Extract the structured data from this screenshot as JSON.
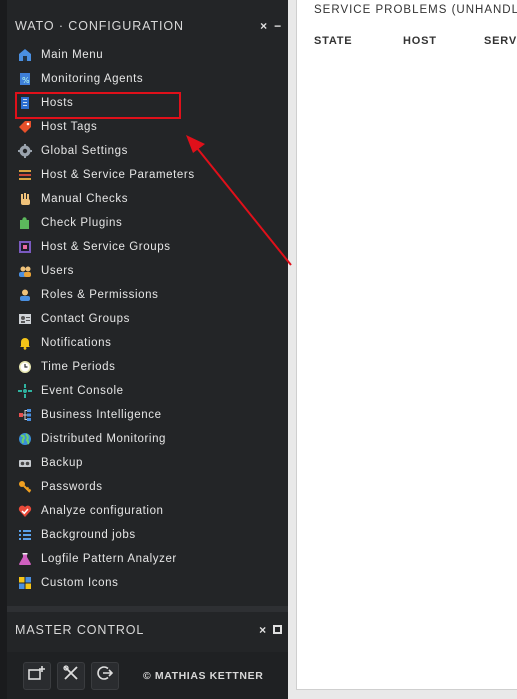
{
  "snapin_config": {
    "title": "WATO · CONFIGURATION",
    "close": "×",
    "minimize": "−"
  },
  "menu": [
    {
      "label": "Main Menu",
      "icon": "main-menu-icon"
    },
    {
      "label": "Monitoring Agents",
      "icon": "agents-icon"
    },
    {
      "label": "Hosts",
      "icon": "hosts-icon"
    },
    {
      "label": "Host Tags",
      "icon": "tag-icon"
    },
    {
      "label": "Global Settings",
      "icon": "gear-icon"
    },
    {
      "label": "Host & Service Parameters",
      "icon": "rulesets-icon"
    },
    {
      "label": "Manual Checks",
      "icon": "hand-icon"
    },
    {
      "label": "Check Plugins",
      "icon": "puzzle-icon"
    },
    {
      "label": "Host & Service Groups",
      "icon": "groups-icon"
    },
    {
      "label": "Users",
      "icon": "users-icon"
    },
    {
      "label": "Roles & Permissions",
      "icon": "roles-icon"
    },
    {
      "label": "Contact Groups",
      "icon": "contact-groups-icon"
    },
    {
      "label": "Notifications",
      "icon": "bell-icon"
    },
    {
      "label": "Time Periods",
      "icon": "clock-icon"
    },
    {
      "label": "Event Console",
      "icon": "event-console-icon"
    },
    {
      "label": "Business Intelligence",
      "icon": "bi-icon"
    },
    {
      "label": "Distributed Monitoring",
      "icon": "globe-icon"
    },
    {
      "label": "Backup",
      "icon": "backup-icon"
    },
    {
      "label": "Passwords",
      "icon": "key-icon"
    },
    {
      "label": "Analyze configuration",
      "icon": "heart-check-icon"
    },
    {
      "label": "Background jobs",
      "icon": "list-icon"
    },
    {
      "label": "Logfile Pattern Analyzer",
      "icon": "flask-icon"
    },
    {
      "label": "Custom Icons",
      "icon": "custom-icons-icon"
    }
  ],
  "snapin_master": {
    "title": "MASTER CONTROL",
    "close": "×"
  },
  "footer": {
    "copyright": "© MATHIAS KETTNER"
  },
  "main": {
    "title": "SERVICE PROBLEMS (UNHANDLED)",
    "columns": [
      "STATE",
      "HOST",
      "SERVICE"
    ]
  },
  "colors": {
    "sidebar_bg": "#232527",
    "highlight": "#e0101a",
    "arrow": "#e0101a"
  }
}
